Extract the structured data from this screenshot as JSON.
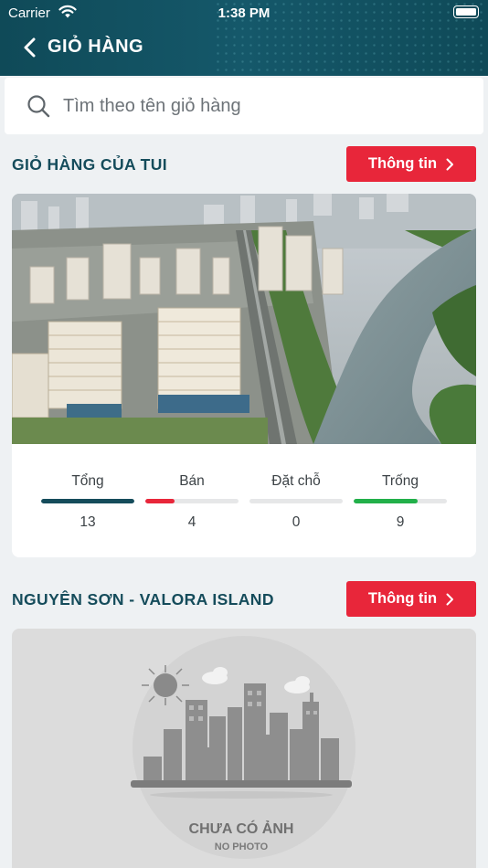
{
  "status_bar": {
    "carrier": "Carrier",
    "time": "1:38 PM"
  },
  "nav": {
    "title": "GIỎ HÀNG",
    "back_icon": "chevron-left-icon"
  },
  "search": {
    "placeholder": "Tìm theo tên giỏ hàng",
    "value": "",
    "icon": "search-icon"
  },
  "colors": {
    "header": "#124f5e",
    "accent": "#e8263a",
    "title": "#154c5b"
  },
  "projects": [
    {
      "name": "GIỎ HÀNG CỦA TUI",
      "info_label": "Thông tin",
      "has_photo": true,
      "stats": [
        {
          "label": "Tổng",
          "value": "13",
          "fraction": 1.0,
          "color": "#154c5b"
        },
        {
          "label": "Bán",
          "value": "4",
          "fraction": 0.31,
          "color": "#e8263a"
        },
        {
          "label": "Đặt chỗ",
          "value": "0",
          "fraction": 0.0,
          "color": "#f0a020"
        },
        {
          "label": "Trống",
          "value": "9",
          "fraction": 0.69,
          "color": "#22b04a"
        }
      ]
    },
    {
      "name": "NGUYÊN SƠN - VALORA ISLAND",
      "info_label": "Thông tin",
      "has_photo": false,
      "placeholder_title": "CHƯA CÓ ẢNH",
      "placeholder_sub": "NO PHOTO"
    }
  ]
}
